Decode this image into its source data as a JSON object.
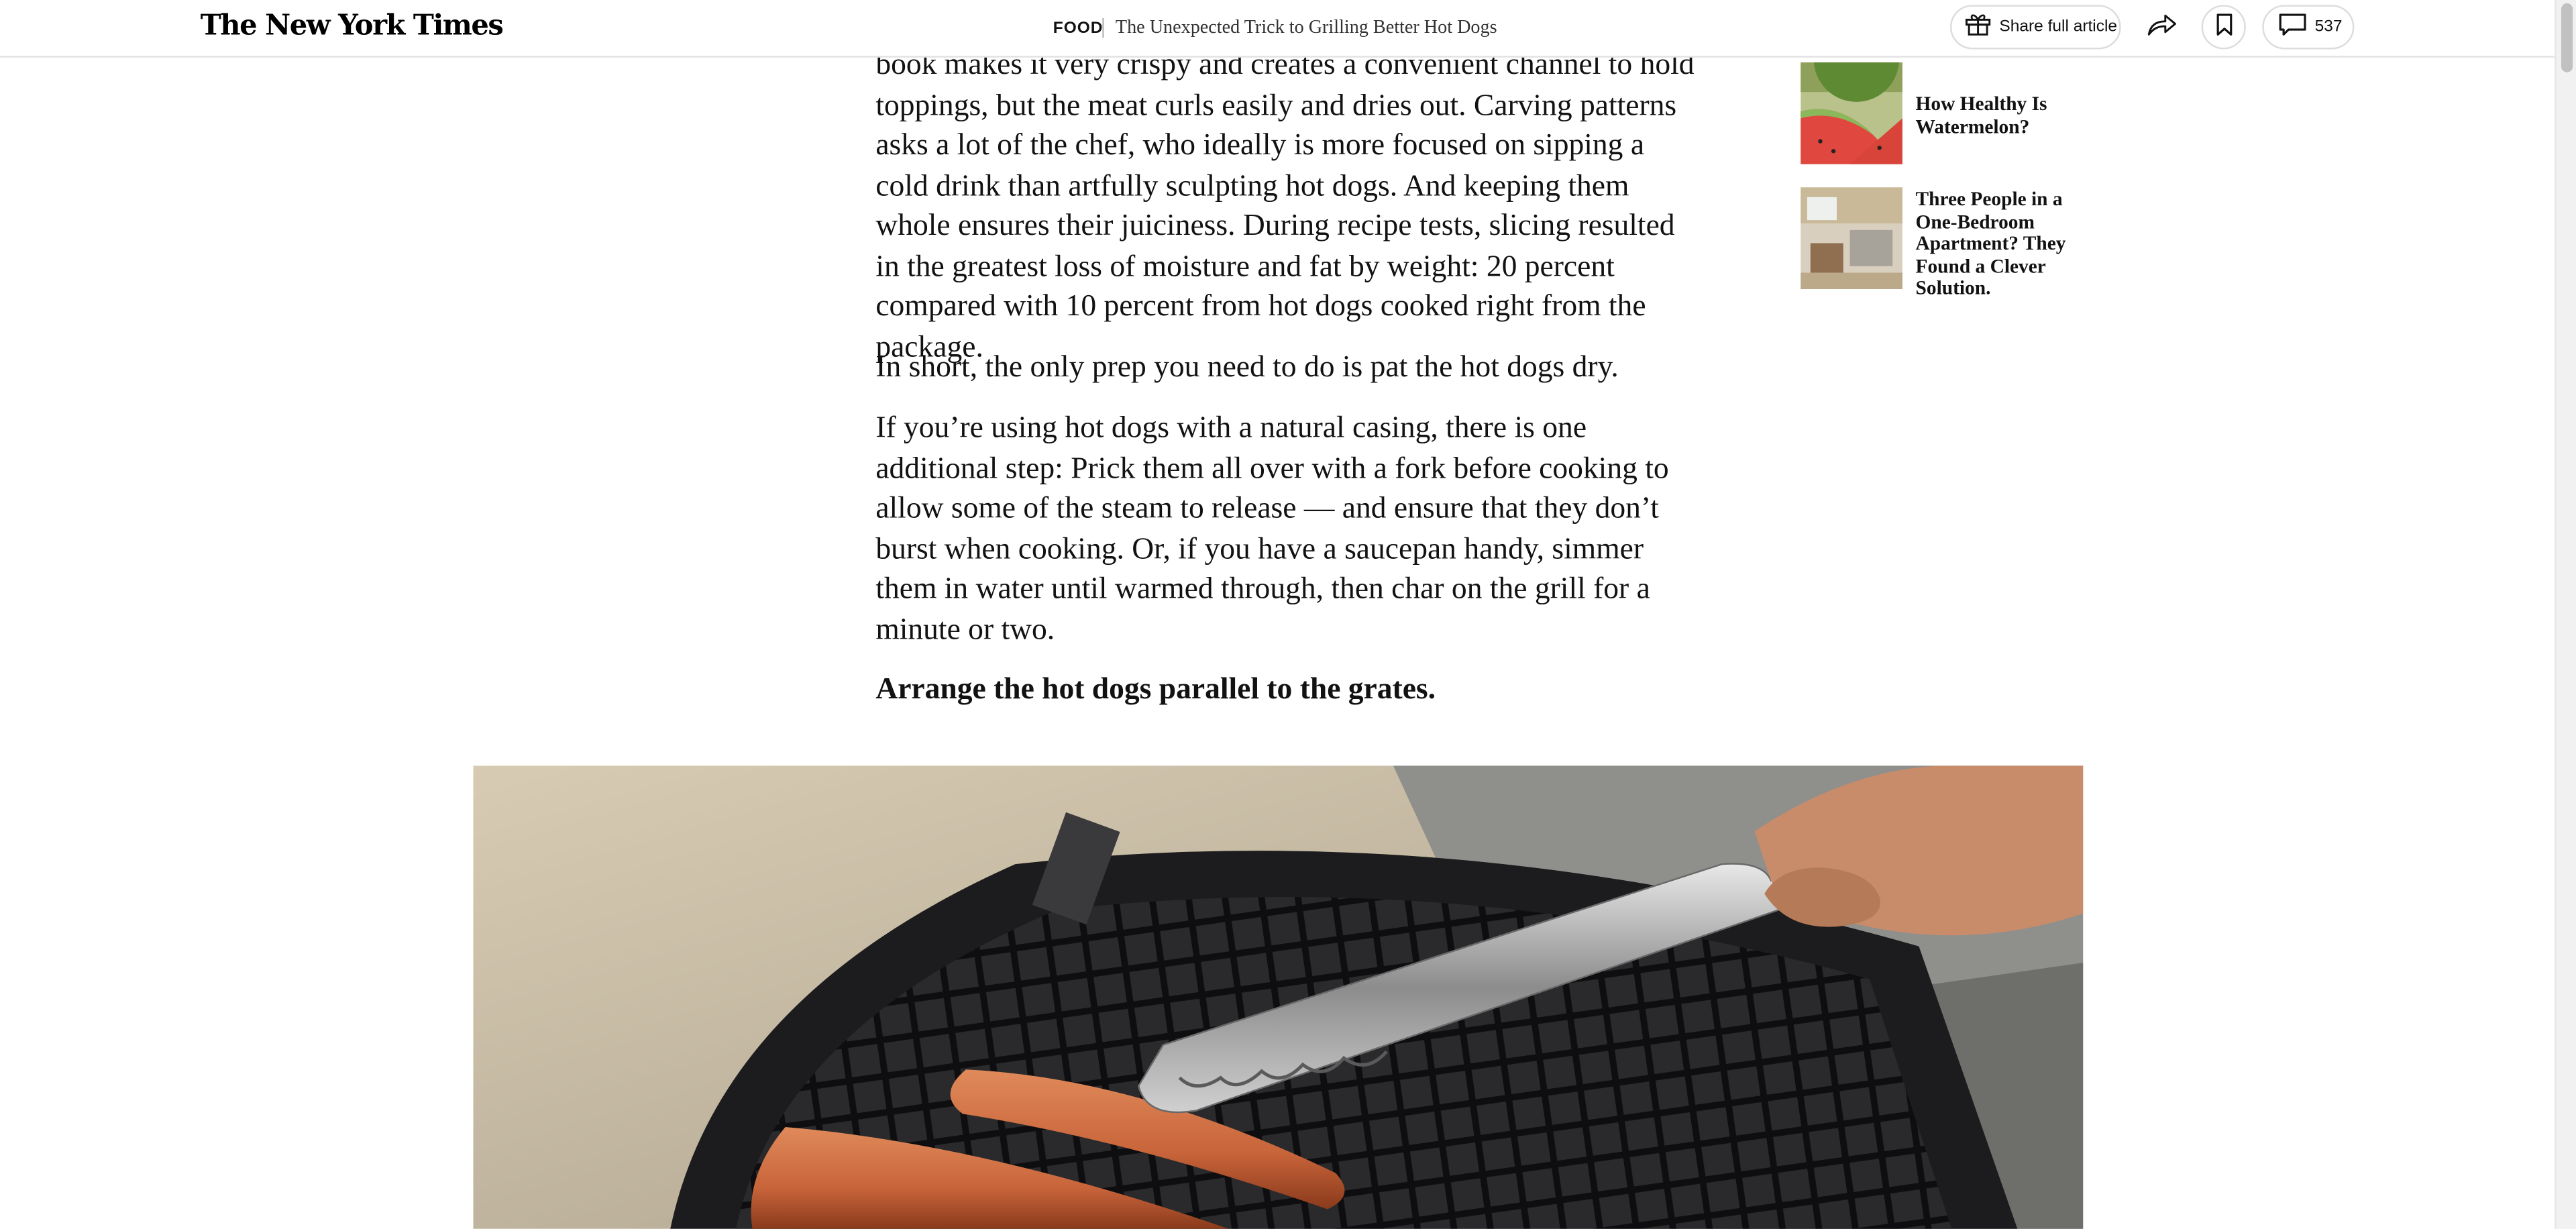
{
  "header": {
    "logo": "The New York Times",
    "section": "FOOD",
    "headline": "The Unexpected Trick to Grilling Better Hot Dogs",
    "share_label": "Share full article",
    "comment_count": "537"
  },
  "article": {
    "p1": "book makes it very crispy and creates a convenient channel to hold toppings, but the meat curls easily and dries out. Carving patterns asks a lot of the chef, who ideally is more focused on sipping a cold drink than artfully sculpting hot dogs. And keeping them whole ensures their juiciness. During recipe tests, slicing resulted in the greatest loss of moisture and fat by weight: 20 percent compared with 10 percent from hot dogs cooked right from the package.",
    "p2": "In short, the only prep you need to do is pat the hot dogs dry.",
    "p3": "If you’re using hot dogs with a natural casing, there is one additional step: Prick them all over with a fork before cooking to allow some of the steam to release — and ensure that they don’t burst when cooking. Or, if you have a saucepan handy, simmer them in water until warmed through, then char on the grill for a minute or two.",
    "subhead": "Arrange the hot dogs parallel to the grates."
  },
  "sidebar": {
    "items": [
      {
        "title": "How Healthy Is Watermelon?"
      },
      {
        "title": "Three People in a One-Bedroom Apartment? They Found a Clever Solution."
      }
    ]
  },
  "colors": {
    "text": "#121212",
    "border": "#dcdcdc",
    "grill": "#1c1c1e",
    "hotdog": "#c8643a"
  },
  "icons": [
    "gift-icon",
    "share-arrow-icon",
    "bookmark-icon",
    "comment-icon"
  ]
}
